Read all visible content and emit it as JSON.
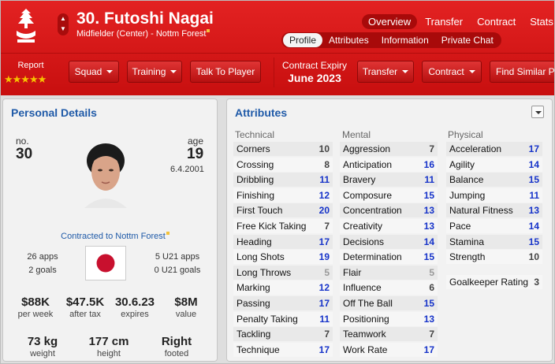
{
  "player": {
    "name": "30. Futoshi Nagai",
    "position": "Midfielder (Center) - Nottm Forest"
  },
  "top_tabs": [
    "Overview",
    "Transfer",
    "Contract",
    "Stats"
  ],
  "sub_tabs": [
    "Profile",
    "Attributes",
    "Information",
    "Private Chat"
  ],
  "report": {
    "label": "Report",
    "stars": "★★★★★",
    "stars_value": 4.5,
    "stars_max": 5
  },
  "buttons": {
    "squad": "Squad",
    "training": "Training",
    "talk": "Talk To Player",
    "transfer": "Transfer",
    "contract": "Contract",
    "find_similar": "Find Similar P"
  },
  "contract_expiry": {
    "label": "Contract Expiry",
    "value": "June 2023"
  },
  "personal": {
    "title": "Personal Details",
    "no_label": "no.",
    "no_value": "30",
    "age_label": "age",
    "age_value": "19",
    "dob": "6.4.2001",
    "contracted": "Contracted to Nottm Forest",
    "apps": "26 apps",
    "goals": "2 goals",
    "u21_apps": "5 U21 apps",
    "u21_goals": "0 U21 goals",
    "wage": "$88K",
    "wage_cap": "per week",
    "after_tax": "$47.5K",
    "after_tax_cap": "after tax",
    "expires": "30.6.23",
    "expires_cap": "expires",
    "value": "$8M",
    "value_cap": "value",
    "weight": "73 kg",
    "weight_cap": "weight",
    "height": "177 cm",
    "height_cap": "height",
    "foot": "Right",
    "foot_cap": "footed"
  },
  "attributes": {
    "title": "Attributes",
    "technical_label": "Technical",
    "mental_label": "Mental",
    "physical_label": "Physical",
    "technical": [
      {
        "name": "Corners",
        "value": "10"
      },
      {
        "name": "Crossing",
        "value": "8"
      },
      {
        "name": "Dribbling",
        "value": "11"
      },
      {
        "name": "Finishing",
        "value": "12"
      },
      {
        "name": "First Touch",
        "value": "20"
      },
      {
        "name": "Free Kick Taking",
        "value": "7"
      },
      {
        "name": "Heading",
        "value": "17"
      },
      {
        "name": "Long Shots",
        "value": "19"
      },
      {
        "name": "Long Throws",
        "value": "5"
      },
      {
        "name": "Marking",
        "value": "12"
      },
      {
        "name": "Passing",
        "value": "17"
      },
      {
        "name": "Penalty Taking",
        "value": "11"
      },
      {
        "name": "Tackling",
        "value": "7"
      },
      {
        "name": "Technique",
        "value": "17"
      }
    ],
    "mental": [
      {
        "name": "Aggression",
        "value": "7"
      },
      {
        "name": "Anticipation",
        "value": "16"
      },
      {
        "name": "Bravery",
        "value": "11"
      },
      {
        "name": "Composure",
        "value": "15"
      },
      {
        "name": "Concentration",
        "value": "13"
      },
      {
        "name": "Creativity",
        "value": "13"
      },
      {
        "name": "Decisions",
        "value": "14"
      },
      {
        "name": "Determination",
        "value": "15"
      },
      {
        "name": "Flair",
        "value": "5"
      },
      {
        "name": "Influence",
        "value": "6"
      },
      {
        "name": "Off The Ball",
        "value": "15"
      },
      {
        "name": "Positioning",
        "value": "13"
      },
      {
        "name": "Teamwork",
        "value": "7"
      },
      {
        "name": "Work Rate",
        "value": "17"
      }
    ],
    "physical": [
      {
        "name": "Acceleration",
        "value": "17"
      },
      {
        "name": "Agility",
        "value": "14"
      },
      {
        "name": "Balance",
        "value": "15"
      },
      {
        "name": "Jumping",
        "value": "11"
      },
      {
        "name": "Natural Fitness",
        "value": "13"
      },
      {
        "name": "Pace",
        "value": "14"
      },
      {
        "name": "Stamina",
        "value": "15"
      },
      {
        "name": "Strength",
        "value": "10"
      }
    ],
    "goalkeeper_label": "Goalkeeper Rating",
    "goalkeeper_value": "3"
  },
  "colors": {
    "header_red": "#d61a1a",
    "title_blue": "#1f5aa8",
    "value_blue": "#1633c9"
  }
}
